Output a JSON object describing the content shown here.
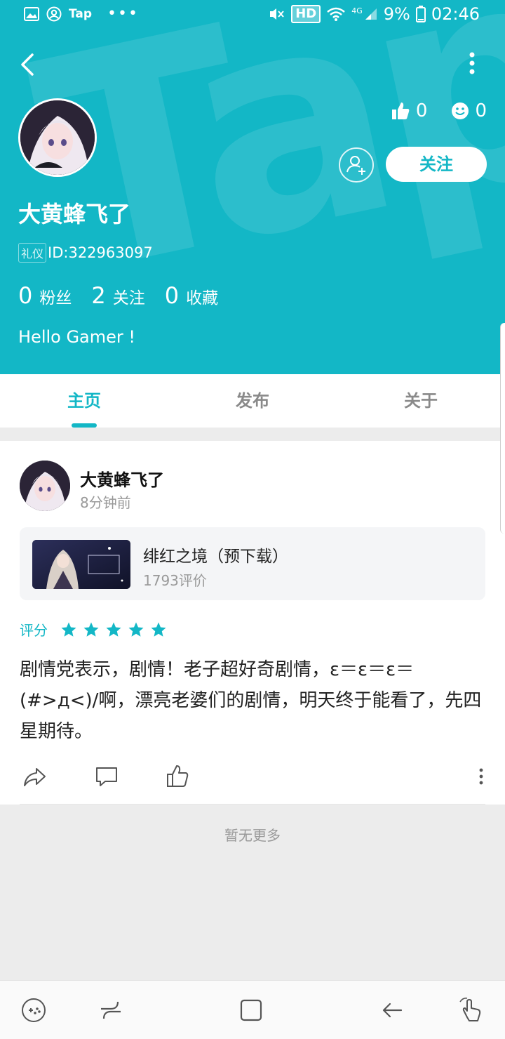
{
  "status_bar": {
    "app_label": "Tap",
    "hd": "HD",
    "network": "4G",
    "battery": "9%",
    "time": "02:46"
  },
  "profile": {
    "likes": "0",
    "smiles": "0",
    "follow_label": "关注",
    "name": "大黄蜂飞了",
    "badge": "礼仪",
    "id_text": "ID:322963097",
    "fans_count": "0",
    "fans_label": "粉丝",
    "following_count": "2",
    "following_label": "关注",
    "collect_count": "0",
    "collect_label": "收藏",
    "bio": "Hello Gamer !"
  },
  "tabs": [
    {
      "label": "主页",
      "active": true
    },
    {
      "label": "发布",
      "active": false
    },
    {
      "label": "关于",
      "active": false
    }
  ],
  "post": {
    "author": "大黄蜂飞了",
    "time": "8分钟前",
    "game_title": "绯红之境（预下载）",
    "game_reviews": "1793评价",
    "rating_label": "评分",
    "rating_stars": 5,
    "text": "剧情党表示，剧情！老子超好奇剧情，ε＝ε＝ε＝(#>д<)/啊，漂亮老婆们的剧情，明天终于能看了，先四星期待。"
  },
  "footer_text": "暂无更多",
  "colors": {
    "accent": "#13b7c6",
    "header_bg": "#13b7c6",
    "page_bg": "#ececec"
  }
}
